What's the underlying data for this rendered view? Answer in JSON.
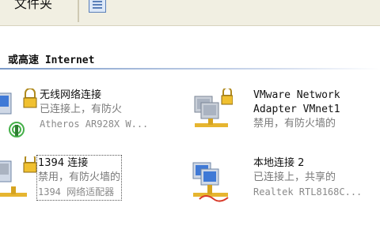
{
  "toolbar": {
    "folders_label": "文件夹"
  },
  "group": {
    "title": "或高速 Internet"
  },
  "connections": [
    {
      "name": "无线网络连接",
      "status": "已连接上，有防火",
      "device": "Atheros AR928X W..."
    },
    {
      "name": "VMware Network",
      "name2": "Adapter VMnet1",
      "status": "禁用，有防火墙的"
    },
    {
      "name": "1394 连接",
      "status": "禁用，有防火墙的",
      "device": "1394 网络适配器"
    },
    {
      "name": "本地连接 2",
      "status": "已连接上，共享的",
      "device": "Realtek RTL8168C..."
    }
  ]
}
